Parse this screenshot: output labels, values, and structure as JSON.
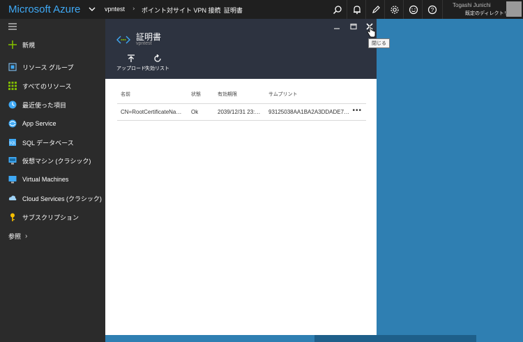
{
  "topbar": {
    "brand": "Microsoft Azure",
    "breadcrumb": [
      "vpntest",
      "ポイント対サイト VPN 接続",
      "証明書"
    ],
    "user_name": "Togashi Junichi",
    "user_directory": "既定のディレクトリ"
  },
  "sidebar": {
    "new_label": "新規",
    "items": [
      {
        "label": "リソース グループ",
        "icon": "resource-groups-icon"
      },
      {
        "label": "すべてのリソース",
        "icon": "all-resources-icon"
      },
      {
        "label": "最近使った項目",
        "icon": "recent-icon"
      },
      {
        "label": "App Service",
        "icon": "app-service-icon"
      },
      {
        "label": "SQL データベース",
        "icon": "sql-database-icon"
      },
      {
        "label": "仮想マシン (クラシック)",
        "icon": "vm-classic-icon"
      },
      {
        "label": "Virtual Machines",
        "icon": "virtual-machines-icon"
      },
      {
        "label": "Cloud Services (クラシック)",
        "icon": "cloud-services-icon"
      },
      {
        "label": "サブスクリプション",
        "icon": "subscriptions-icon"
      }
    ],
    "browse_label": "参照"
  },
  "blade": {
    "title": "証明書",
    "subtitle": "vpntest",
    "toolbar": {
      "upload_label": "アップロード",
      "revoked_label": "失効リスト"
    },
    "close_tooltip": "閉じる"
  },
  "grid": {
    "columns": [
      "名前",
      "状態",
      "有効期限",
      "サムプリント"
    ],
    "rows": [
      {
        "name": "CN=RootCertificateNa…",
        "status": "Ok",
        "expiry": "2039/12/31 23:…",
        "thumbprint": "93125038AA1BA2A3DDADE7…"
      }
    ],
    "more_label": "•••"
  },
  "colors": {
    "brand": "#3fa9f5",
    "topbar_bg": "#1f1f1f",
    "sidebar_bg": "#2b2b2b",
    "blade_header_bg": "#2d3340",
    "desktop_bg": "#2f7fb2"
  }
}
